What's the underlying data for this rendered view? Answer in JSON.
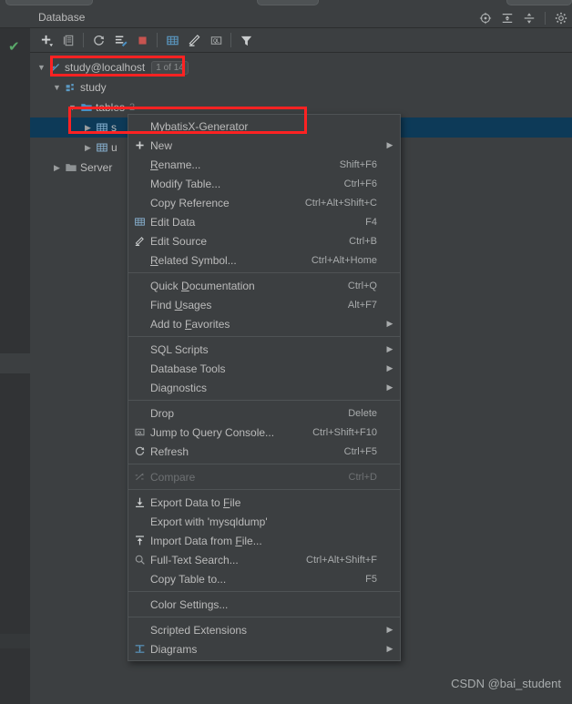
{
  "window": {
    "top_tabs": [
      "",
      "",
      ""
    ]
  },
  "header": {
    "title": "Database",
    "icons": [
      {
        "name": "scope-icon",
        "glyph": "⊕"
      },
      {
        "name": "expand-all-icon",
        "glyph": "⧉"
      },
      {
        "name": "collapse-all-icon",
        "glyph": "⧉"
      },
      {
        "name": "settings-gear-icon",
        "glyph": "⚙"
      }
    ]
  },
  "toolbar": {
    "buttons": [
      {
        "name": "add-data-source-button",
        "tooltip": "New"
      },
      {
        "name": "duplicate-button",
        "tooltip": "Duplicate"
      },
      {
        "name": "refresh-button",
        "tooltip": "Refresh"
      },
      {
        "name": "data-source-properties-button",
        "tooltip": "Properties"
      },
      {
        "name": "stop-button",
        "tooltip": "Stop"
      },
      {
        "name": "edit-data-button",
        "tooltip": "Edit Data"
      },
      {
        "name": "edit-source-button",
        "tooltip": "Edit Source"
      },
      {
        "name": "query-console-button",
        "tooltip": "Jump to Query Console"
      },
      {
        "name": "filter-button",
        "tooltip": "Filter"
      }
    ]
  },
  "tree": {
    "rows": [
      {
        "name": "tree-item-connection",
        "label": "study@localhost",
        "badge": "1 of 14",
        "icon": "datasource-icon",
        "indent": 0,
        "expanded": true,
        "selected": false
      },
      {
        "name": "tree-item-schema",
        "label": "study",
        "badge": "",
        "icon": "schema-icon",
        "indent": 1,
        "expanded": true,
        "selected": false
      },
      {
        "name": "tree-item-tables-folder",
        "label": "tables",
        "count": "2",
        "icon": "folder-icon",
        "indent": 2,
        "expanded": true,
        "selected": false
      },
      {
        "name": "tree-item-table-first",
        "label": "s",
        "icon": "table-icon",
        "indent": 3,
        "expanded": false,
        "selected": true
      },
      {
        "name": "tree-item-table-second",
        "label": "u",
        "icon": "table-icon",
        "indent": 3,
        "expanded": false,
        "selected": false
      },
      {
        "name": "tree-item-server",
        "label": "Server",
        "icon": "folder-icon",
        "indent": 1,
        "expanded": false,
        "selected": false
      }
    ]
  },
  "context_menu": {
    "items": [
      {
        "name": "menu-item-mybatisx-generator",
        "label": "MybatisX-Generator",
        "shortcut": "",
        "icon": "",
        "submenu": false,
        "disabled": false,
        "separator_after": false
      },
      {
        "name": "menu-item-new",
        "label": "New",
        "shortcut": "",
        "icon": "plus-icon",
        "submenu": true,
        "disabled": false,
        "separator_after": false
      },
      {
        "name": "menu-item-rename",
        "label": "Rename...",
        "shortcut": "Shift+F6",
        "icon": "",
        "submenu": false,
        "disabled": false,
        "separator_after": false
      },
      {
        "name": "menu-item-modify-table",
        "label": "Modify Table...",
        "shortcut": "Ctrl+F6",
        "icon": "",
        "submenu": false,
        "disabled": false,
        "separator_after": false
      },
      {
        "name": "menu-item-copy-reference",
        "label": "Copy Reference",
        "shortcut": "Ctrl+Alt+Shift+C",
        "icon": "",
        "submenu": false,
        "disabled": false,
        "separator_after": false
      },
      {
        "name": "menu-item-edit-data",
        "label": "Edit Data",
        "shortcut": "F4",
        "icon": "table-icon",
        "submenu": false,
        "disabled": false,
        "separator_after": false
      },
      {
        "name": "menu-item-edit-source",
        "label": "Edit Source",
        "shortcut": "Ctrl+B",
        "icon": "pencil-icon",
        "submenu": false,
        "disabled": false,
        "separator_after": false
      },
      {
        "name": "menu-item-related-symbol",
        "label": "Related Symbol...",
        "shortcut": "Ctrl+Alt+Home",
        "icon": "",
        "submenu": false,
        "disabled": false,
        "separator_after": true
      },
      {
        "name": "menu-item-quick-documentation",
        "label": "Quick Documentation",
        "shortcut": "Ctrl+Q",
        "icon": "",
        "submenu": false,
        "disabled": false,
        "separator_after": false
      },
      {
        "name": "menu-item-find-usages",
        "label": "Find Usages",
        "shortcut": "Alt+F7",
        "icon": "",
        "submenu": false,
        "disabled": false,
        "separator_after": false
      },
      {
        "name": "menu-item-add-to-favorites",
        "label": "Add to Favorites",
        "shortcut": "",
        "icon": "",
        "submenu": true,
        "disabled": false,
        "separator_after": true
      },
      {
        "name": "menu-item-sql-scripts",
        "label": "SQL Scripts",
        "shortcut": "",
        "icon": "",
        "submenu": true,
        "disabled": false,
        "separator_after": false
      },
      {
        "name": "menu-item-database-tools",
        "label": "Database Tools",
        "shortcut": "",
        "icon": "",
        "submenu": true,
        "disabled": false,
        "separator_after": false
      },
      {
        "name": "menu-item-diagnostics",
        "label": "Diagnostics",
        "shortcut": "",
        "icon": "",
        "submenu": true,
        "disabled": false,
        "separator_after": true
      },
      {
        "name": "menu-item-drop",
        "label": "Drop",
        "shortcut": "Delete",
        "icon": "",
        "submenu": false,
        "disabled": false,
        "separator_after": false
      },
      {
        "name": "menu-item-jump-to-query-console",
        "label": "Jump to Query Console...",
        "shortcut": "Ctrl+Shift+F10",
        "icon": "query-console-icon",
        "submenu": false,
        "disabled": false,
        "separator_after": false
      },
      {
        "name": "menu-item-refresh",
        "label": "Refresh",
        "shortcut": "Ctrl+F5",
        "icon": "refresh-icon",
        "submenu": false,
        "disabled": false,
        "separator_after": true
      },
      {
        "name": "menu-item-compare",
        "label": "Compare",
        "shortcut": "Ctrl+D",
        "icon": "compare-icon",
        "submenu": false,
        "disabled": true,
        "separator_after": true
      },
      {
        "name": "menu-item-export-data-to-file",
        "label": "Export Data to File",
        "shortcut": "",
        "icon": "export-icon",
        "submenu": false,
        "disabled": false,
        "separator_after": false
      },
      {
        "name": "menu-item-export-with-mysqldump",
        "label": "Export with 'mysqldump'",
        "shortcut": "",
        "icon": "",
        "submenu": false,
        "disabled": false,
        "separator_after": false
      },
      {
        "name": "menu-item-import-data-from-file",
        "label": "Import Data from File...",
        "shortcut": "",
        "icon": "import-icon",
        "submenu": false,
        "disabled": false,
        "separator_after": false
      },
      {
        "name": "menu-item-full-text-search",
        "label": "Full-Text Search...",
        "shortcut": "Ctrl+Alt+Shift+F",
        "icon": "search-icon",
        "submenu": false,
        "disabled": false,
        "separator_after": false
      },
      {
        "name": "menu-item-copy-table-to",
        "label": "Copy Table to...",
        "shortcut": "F5",
        "icon": "",
        "submenu": false,
        "disabled": false,
        "separator_after": true
      },
      {
        "name": "menu-item-color-settings",
        "label": "Color Settings...",
        "shortcut": "",
        "icon": "",
        "submenu": false,
        "disabled": false,
        "separator_after": true
      },
      {
        "name": "menu-item-scripted-extensions",
        "label": "Scripted Extensions",
        "shortcut": "",
        "icon": "",
        "submenu": true,
        "disabled": false,
        "separator_after": false
      },
      {
        "name": "menu-item-diagrams",
        "label": "Diagrams",
        "shortcut": "",
        "icon": "diagram-icon",
        "submenu": true,
        "disabled": false,
        "separator_after": false
      }
    ]
  },
  "annotations": {
    "boxes": [
      {
        "name": "annotation-box-connection",
        "color": "#ff2222"
      },
      {
        "name": "annotation-box-table-row",
        "color": "#ff2222"
      }
    ]
  },
  "watermark": {
    "text": "CSDN @bai_student"
  },
  "colors": {
    "panel_bg": "#3c3f41",
    "strip_bg": "#313335",
    "selected_row": "#0d3a58",
    "text": "#bbbbbb",
    "accent_blue": "#5b9ac4",
    "annotation_red": "#ff2222",
    "check_green": "#59a869",
    "stop_red": "#c75450"
  }
}
